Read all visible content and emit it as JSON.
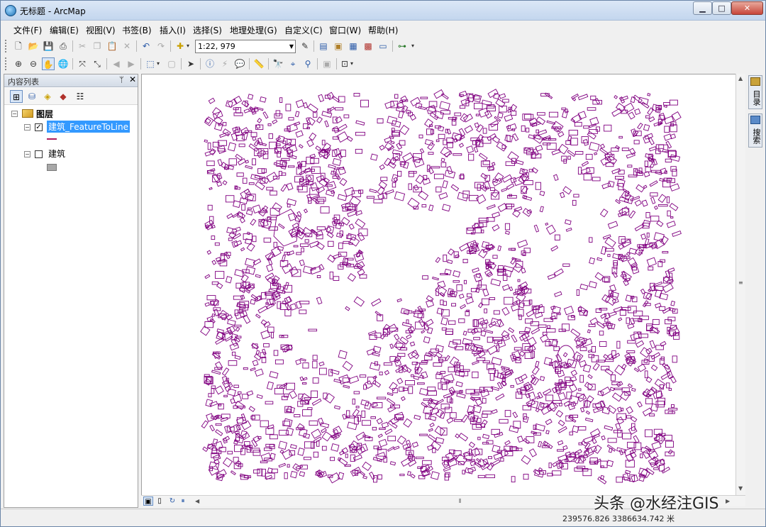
{
  "window": {
    "title": "无标题 - ArcMap",
    "minimize": "▁",
    "maximize": "□",
    "close": "✕"
  },
  "menu": [
    "文件(F)",
    "编辑(E)",
    "视图(V)",
    "书签(B)",
    "插入(I)",
    "选择(S)",
    "地理处理(G)",
    "自定义(C)",
    "窗口(W)",
    "帮助(H)"
  ],
  "toolbar": {
    "scale": "1:22, 979",
    "standard_icons": [
      "new-document-icon",
      "open-icon",
      "save-icon",
      "print-icon",
      "cut-icon",
      "copy-icon",
      "paste-icon",
      "delete-icon",
      "undo-icon",
      "redo-icon",
      "add-data-icon"
    ],
    "tools_icons": [
      "zoom-in-icon",
      "zoom-out-icon",
      "pan-icon",
      "full-extent-icon",
      "fixed-zoom-in-icon",
      "fixed-zoom-out-icon",
      "back-icon",
      "forward-icon",
      "select-features-icon",
      "clear-selection-icon",
      "select-elements-icon",
      "identify-icon",
      "hyperlink-icon",
      "html-popup-icon",
      "measure-icon",
      "find-icon",
      "go-to-xy-icon",
      "time-slider-icon"
    ]
  },
  "toc": {
    "title": "内容列表",
    "pin": "ₐ",
    "close": "✕",
    "root_label": "图层",
    "layers": [
      {
        "label": "建筑_FeatureToLine",
        "checked": true,
        "selected": true,
        "symbol": "line",
        "symbol_color": "#b01c5c"
      },
      {
        "label": "建筑",
        "checked": false,
        "selected": false,
        "symbol": "polygon",
        "symbol_color": "#a8a8a8"
      }
    ]
  },
  "map": {
    "feature_color": "#800080"
  },
  "side_dock": [
    "目录",
    "搜索"
  ],
  "status": {
    "coordinates": "239576.826  3386634.742 米"
  },
  "watermark": "头条 @水经注GIS"
}
